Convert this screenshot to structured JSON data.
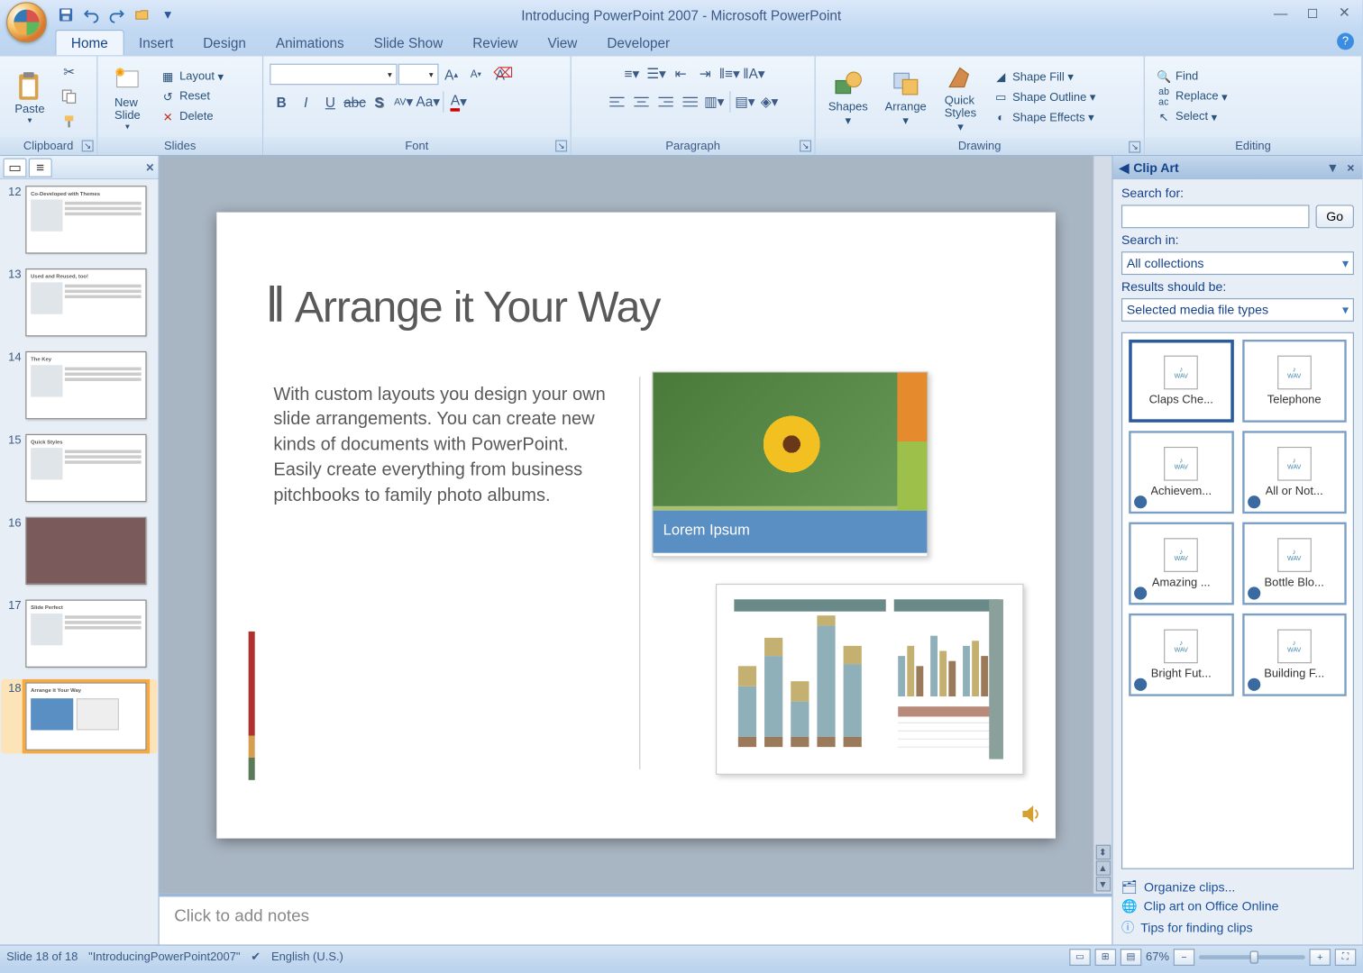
{
  "title": "Introducing PowerPoint 2007 - Microsoft PowerPoint",
  "tabs": [
    "Home",
    "Insert",
    "Design",
    "Animations",
    "Slide Show",
    "Review",
    "View",
    "Developer"
  ],
  "active_tab": 0,
  "ribbon": {
    "clipboard": {
      "label": "Clipboard",
      "paste": "Paste"
    },
    "slides": {
      "label": "Slides",
      "new_slide": "New\nSlide",
      "layout": "Layout",
      "reset": "Reset",
      "delete": "Delete"
    },
    "font": {
      "label": "Font"
    },
    "paragraph": {
      "label": "Paragraph"
    },
    "drawing": {
      "label": "Drawing",
      "shapes": "Shapes",
      "arrange": "Arrange",
      "quick_styles": "Quick\nStyles",
      "shape_fill": "Shape Fill",
      "shape_outline": "Shape Outline",
      "shape_effects": "Shape Effects"
    },
    "editing": {
      "label": "Editing",
      "find": "Find",
      "replace": "Replace",
      "select": "Select"
    }
  },
  "thumbs": [
    {
      "n": 12,
      "t": "Co-Developed with Themes"
    },
    {
      "n": 13,
      "t": "Used and Reused, too!"
    },
    {
      "n": 14,
      "t": "The Key"
    },
    {
      "n": 15,
      "t": "Quick Styles"
    },
    {
      "n": 16,
      "t": ""
    },
    {
      "n": 17,
      "t": "Slide Perfect"
    },
    {
      "n": 18,
      "t": "Arrange it Your Way"
    }
  ],
  "slide": {
    "title": "Arrange it Your Way",
    "body": "With custom layouts you design your own slide arrangements. You can create new kinds of documents with PowerPoint. Easily create everything from business pitchbooks to family photo albums.",
    "caption": "Lorem Ipsum"
  },
  "notes_placeholder": "Click to add notes",
  "clipart": {
    "title": "Clip Art",
    "search_for": "Search for:",
    "go": "Go",
    "search_in": "Search in:",
    "search_in_val": "All collections",
    "results_should_be": "Results should be:",
    "results_val": "Selected media file types",
    "items": [
      {
        "label": "Claps Che...",
        "sel": true,
        "globe": false
      },
      {
        "label": "Telephone",
        "sel": false,
        "globe": false
      },
      {
        "label": "Achievem...",
        "sel": false,
        "globe": true
      },
      {
        "label": "All or Not...",
        "sel": false,
        "globe": true
      },
      {
        "label": "Amazing ...",
        "sel": false,
        "globe": true
      },
      {
        "label": "Bottle Blo...",
        "sel": false,
        "globe": true
      },
      {
        "label": "Bright Fut...",
        "sel": false,
        "globe": true
      },
      {
        "label": "Building F...",
        "sel": false,
        "globe": true
      }
    ],
    "organize": "Organize clips...",
    "online": "Clip art on Office Online",
    "tips": "Tips for finding clips"
  },
  "status": {
    "slide_of": "Slide 18 of 18",
    "file": "\"IntroducingPowerPoint2007\"",
    "lang": "English (U.S.)",
    "zoom": "67%"
  }
}
